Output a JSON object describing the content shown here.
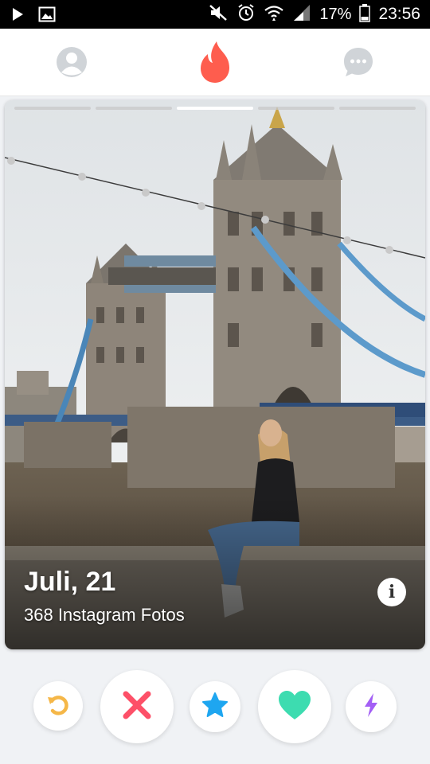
{
  "status_bar": {
    "battery_percent": "17%",
    "time": "23:56",
    "icons": [
      "play-icon",
      "image-icon",
      "mute-icon",
      "alarm-icon",
      "wifi-icon",
      "signal-icon",
      "battery-icon"
    ]
  },
  "top_nav": {
    "icons": [
      "profile-icon",
      "flame-icon",
      "chat-icon"
    ],
    "colors": {
      "inactive": "#d0d4d8",
      "accent": "#fe5d4e"
    }
  },
  "card": {
    "photo_count": 5,
    "active_photo_index": 2,
    "name_age": "Juli, 21",
    "subtitle": "368 Instagram Fotos",
    "info_label": "i"
  },
  "actions": {
    "buttons": [
      {
        "icon": "rewind-icon",
        "color": "#f5b748"
      },
      {
        "icon": "nope-icon",
        "color": "#fd5068"
      },
      {
        "icon": "super-like-icon",
        "color": "#1ea6f0"
      },
      {
        "icon": "like-icon",
        "color": "#3ddcb0"
      },
      {
        "icon": "boost-icon",
        "color": "#a35ff5"
      }
    ]
  }
}
